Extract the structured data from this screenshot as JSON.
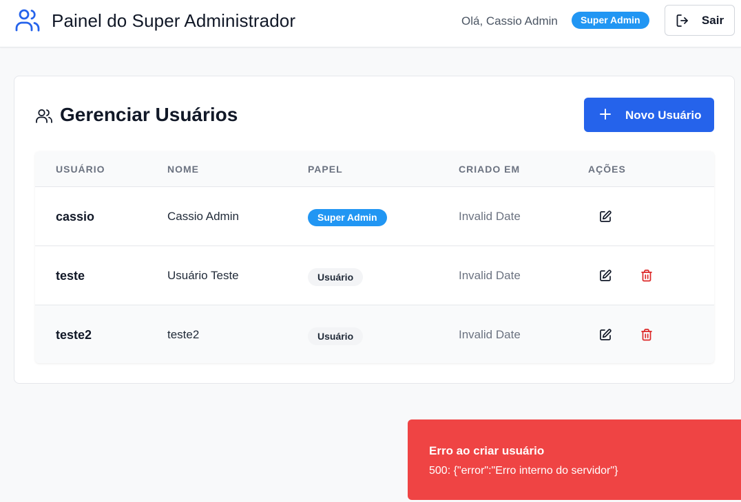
{
  "header": {
    "title": "Painel do Super Administrador",
    "greeting": "Olá, Cassio Admin",
    "role_badge": "Super Admin",
    "logout_label": "Sair"
  },
  "card": {
    "title": "Gerenciar Usuários",
    "new_user_label": "Novo Usuário"
  },
  "table": {
    "columns": [
      "USUÁRIO",
      "NOME",
      "PAPEL",
      "CRIADO EM",
      "AÇÕES"
    ],
    "rows": [
      {
        "username": "cassio",
        "name": "Cassio Admin",
        "role": "Super Admin",
        "created": "Invalid Date",
        "actions": [
          "edit-icon"
        ]
      },
      {
        "username": "teste",
        "name": "Usuário Teste",
        "role": "Usuário",
        "created": "Invalid Date",
        "actions": [
          "edit-icon",
          "trash-icon"
        ]
      },
      {
        "username": "teste2",
        "name": "teste2",
        "role": "Usuário",
        "created": "Invalid Date",
        "actions": [
          "edit-icon",
          "trash-icon"
        ]
      }
    ]
  },
  "toast": {
    "title": "Erro ao criar usuário",
    "description": "500: {\"error\":\"Erro interno do servidor\"}"
  },
  "colors": {
    "primary": "#2563eb",
    "badge_blue": "#2196f3",
    "danger": "#ef4444",
    "delete_icon": "#dc2626"
  }
}
